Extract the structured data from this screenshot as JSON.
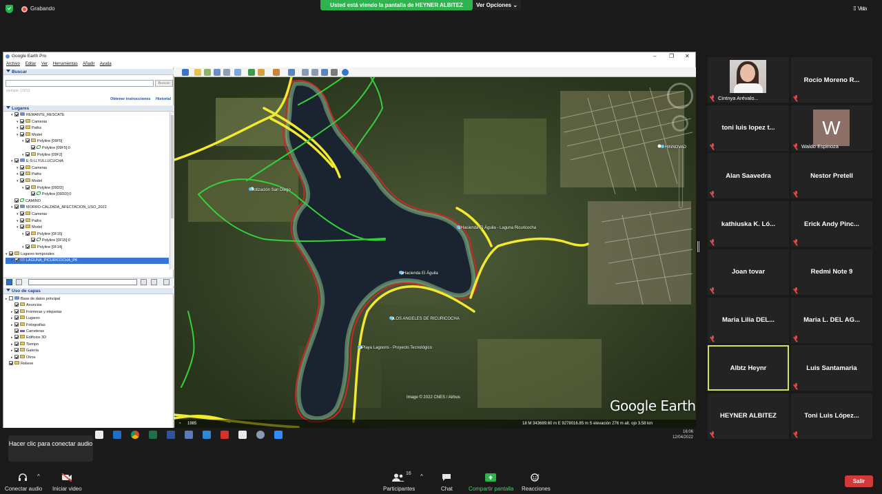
{
  "top": {
    "recording_label": "Grabando",
    "share_banner": "Usted está viendo la pantalla de HEYNER ALBITEZ",
    "view_options": "Ver Opciones",
    "view_label": "Vista"
  },
  "ge": {
    "title": "Google Earth Pro",
    "menu": [
      "Archivo",
      "Editar",
      "Ver",
      "Herramientas",
      "Añadir",
      "Ayuda"
    ],
    "search_header": "Buscar",
    "search_button": "Buscar",
    "search_hint": "ejemplo: 10213",
    "links": [
      "Obtener instrucciones",
      "Historial"
    ],
    "places_header": "Lugares",
    "layers_header": "Uso de capas",
    "places": [
      {
        "label": "REMANTE_RESCATE",
        "depth": 1,
        "icon": "kml"
      },
      {
        "label": "Cameras",
        "depth": 2,
        "icon": "folder"
      },
      {
        "label": "Paths",
        "depth": 2,
        "icon": "folder"
      },
      {
        "label": "Model",
        "depth": 2,
        "icon": "folder"
      },
      {
        "label": "Polyline [09F5]",
        "depth": 3,
        "icon": "folder"
      },
      {
        "label": "Polyline [09F5]:0",
        "depth": 4,
        "icon": "poly"
      },
      {
        "label": "Polyline [09F2]",
        "depth": 3,
        "icon": "folder"
      },
      {
        "label": "E-S-LLYULLUCUCHA",
        "depth": 1,
        "icon": "kml"
      },
      {
        "label": "Cameras",
        "depth": 2,
        "icon": "folder"
      },
      {
        "label": "Paths",
        "depth": 2,
        "icon": "folder"
      },
      {
        "label": "Model",
        "depth": 2,
        "icon": "folder"
      },
      {
        "label": "Polyline [09DD]",
        "depth": 3,
        "icon": "folder"
      },
      {
        "label": "Polyline [09DD]:0",
        "depth": 4,
        "icon": "poly"
      },
      {
        "label": "CAMINO",
        "depth": 1,
        "icon": "poly"
      },
      {
        "label": "MORRO-CALZADA_AFECTACION_USO_2022",
        "depth": 1,
        "icon": "kml"
      },
      {
        "label": "Cameras",
        "depth": 2,
        "icon": "folder"
      },
      {
        "label": "Paths",
        "depth": 2,
        "icon": "folder"
      },
      {
        "label": "Model",
        "depth": 2,
        "icon": "folder"
      },
      {
        "label": "Polyline [0F15]",
        "depth": 3,
        "icon": "folder"
      },
      {
        "label": "Polyline [0F15]:0",
        "depth": 4,
        "icon": "poly"
      },
      {
        "label": "Polyline [0F14]",
        "depth": 3,
        "icon": "folder"
      },
      {
        "label": "Lugares temporales",
        "depth": 0,
        "icon": "folder"
      },
      {
        "label": "LAGUNA_PICURICOCHA_PK",
        "depth": 1,
        "icon": "kml"
      }
    ],
    "layers": [
      {
        "label": "Base de datos principal",
        "depth": 0,
        "icon": "kml"
      },
      {
        "label": "Anuncios",
        "depth": 1,
        "icon": "folder"
      },
      {
        "label": "Fronteras y etiquetas",
        "depth": 1,
        "icon": "folder"
      },
      {
        "label": "Lugares",
        "depth": 1,
        "icon": "folder"
      },
      {
        "label": "Fotografías",
        "depth": 1,
        "icon": "folder"
      },
      {
        "label": "Carreteras",
        "depth": 1,
        "icon": "path"
      },
      {
        "label": "Edificios 3D",
        "depth": 1,
        "icon": "folder"
      },
      {
        "label": "Tiempo",
        "depth": 1,
        "icon": "folder"
      },
      {
        "label": "Galería",
        "depth": 1,
        "icon": "folder"
      },
      {
        "label": "Otros",
        "depth": 1,
        "icon": "folder"
      },
      {
        "label": "Relieve",
        "depth": 0,
        "icon": "folder"
      }
    ],
    "map_labels": {
      "hinnovad": "HINNOVAD",
      "lotizacion": "lotización San Diego",
      "hacienda_laguna": "Hacienda El Águila - Laguna Ricuricocha",
      "hacienda": "Hacienda El Águila",
      "los_angeles": "LOS ANGELES DE RICURICOCHA",
      "playa": "Playa Lagoons - Proyecto Tecnológico"
    },
    "credit": "Image © 2022 CNES / Airbus",
    "brand": "Google Earth",
    "year": "1985",
    "coords": "18 M 343689.60 m E 9278016.85 m S   elevación   276 m      alt. ojo   3.58 km",
    "time": "16:06",
    "date": "12/04/2022"
  },
  "tooltip": "Hacer clic para conectar audio",
  "participants": [
    {
      "name": "Cintnya Arévalo...",
      "type": "photo"
    },
    {
      "name": "Rocío Moreno R...",
      "type": "name"
    },
    {
      "name": "toni luis lopez t...",
      "type": "name"
    },
    {
      "name": "Waldo Espinoza",
      "type": "letter",
      "letter": "W"
    },
    {
      "name": "Alan Saavedra",
      "type": "name"
    },
    {
      "name": "Nestor Pretell",
      "type": "name"
    },
    {
      "name": "kathiuska K. Ló...",
      "type": "name"
    },
    {
      "name": "Erick Andy Pinc...",
      "type": "name"
    },
    {
      "name": "Joan tovar",
      "type": "name"
    },
    {
      "name": "Redmi Note 9",
      "type": "name"
    },
    {
      "name": "Maria Lilia DEL...",
      "type": "name"
    },
    {
      "name": "Maria L. DEL AG...",
      "type": "name"
    },
    {
      "name": "Albtz Heynr",
      "type": "name",
      "active": true
    },
    {
      "name": "Luis Santamaria",
      "type": "name"
    },
    {
      "name": "HEYNER ALBITEZ",
      "type": "name"
    },
    {
      "name": "Toni Luis López...",
      "type": "name"
    }
  ],
  "bottom": {
    "connect_audio": "Conectar audio",
    "start_video": "Iniciar video",
    "participants": "Participantes",
    "participant_count": "16",
    "chat": "Chat",
    "share_screen": "Compartir pantalla",
    "reactions": "Reacciones",
    "leave": "Salir"
  },
  "colors": {
    "accent_green": "#2fb34f",
    "leave_red": "#d23a3a",
    "active_border": "#d8e05a",
    "route_yellow": "#f2ea2e",
    "route_green": "#35d13a",
    "shore_red": "#c8282c"
  }
}
